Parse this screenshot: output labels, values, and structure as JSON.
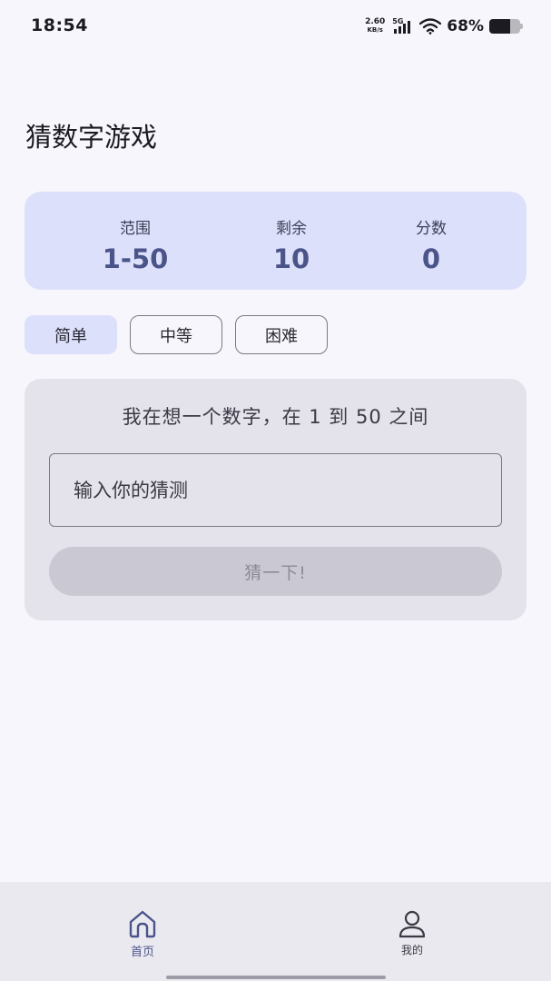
{
  "status_bar": {
    "time": "18:54",
    "net_speed_value": "2.60",
    "net_speed_unit": "KB/s",
    "network_type": "5G",
    "battery_percent": "68%",
    "battery_level": 0.68
  },
  "page": {
    "title": "猜数字游戏"
  },
  "stats": {
    "range_label": "范围",
    "range_value": "1-50",
    "remaining_label": "剩余",
    "remaining_value": "10",
    "score_label": "分数",
    "score_value": "0"
  },
  "difficulty": {
    "options": [
      "简单",
      "中等",
      "困难"
    ],
    "selected": "简单"
  },
  "game": {
    "prompt": "我在想一个数字，在 1 到 50 之间",
    "input_placeholder": "输入你的猜测",
    "input_value": "",
    "guess_button_label": "猜一下!"
  },
  "bottom_nav": {
    "items": [
      {
        "label": "首页",
        "icon": "home-icon",
        "active": true
      },
      {
        "label": "我的",
        "icon": "person-icon",
        "active": false
      }
    ]
  },
  "colors": {
    "background": "#f7f6fc",
    "stats_card": "#dde0fb",
    "accent": "#4a5488",
    "game_card": "#e4e2ea",
    "button_disabled": "#cac8d2"
  }
}
